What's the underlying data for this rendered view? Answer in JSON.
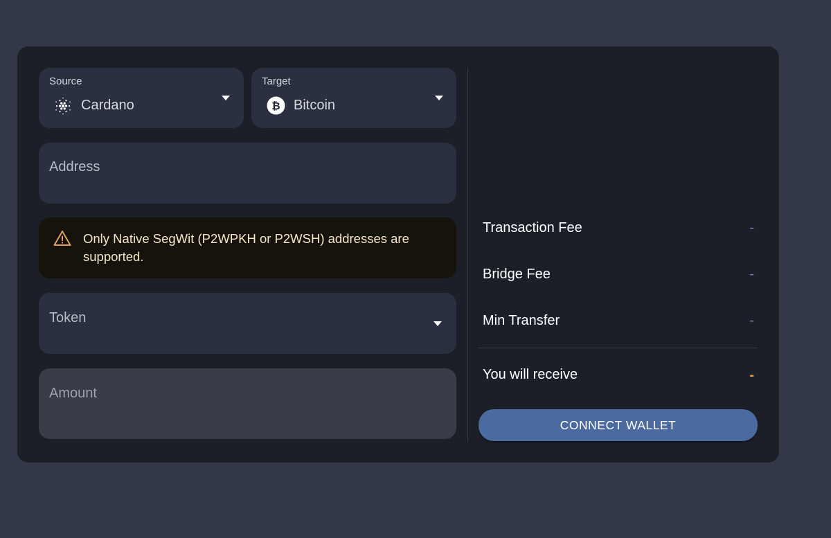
{
  "source": {
    "label": "Source",
    "value": "Cardano",
    "icon": "cardano-icon"
  },
  "target": {
    "label": "Target",
    "value": "Bitcoin",
    "icon": "bitcoin-icon"
  },
  "address": {
    "placeholder": "Address"
  },
  "warning": {
    "icon": "warning-triangle-icon",
    "text": "Only Native SegWit (P2WPKH or P2WSH) addresses are supported.",
    "color": "#e0a060"
  },
  "token": {
    "placeholder": "Token"
  },
  "amount": {
    "placeholder": "Amount"
  },
  "fees": {
    "transaction_fee_label": "Transaction Fee",
    "transaction_fee_value": "-",
    "bridge_fee_label": "Bridge Fee",
    "bridge_fee_value": "-",
    "min_transfer_label": "Min Transfer",
    "min_transfer_value": "-",
    "receive_label": "You will receive",
    "receive_value": "-"
  },
  "actions": {
    "connect_wallet_label": "CONNECT WALLET"
  },
  "colors": {
    "accent": "#4a6aa0",
    "receive_value": "#f0a030",
    "background": "#323848",
    "card": "#1c1f28"
  }
}
